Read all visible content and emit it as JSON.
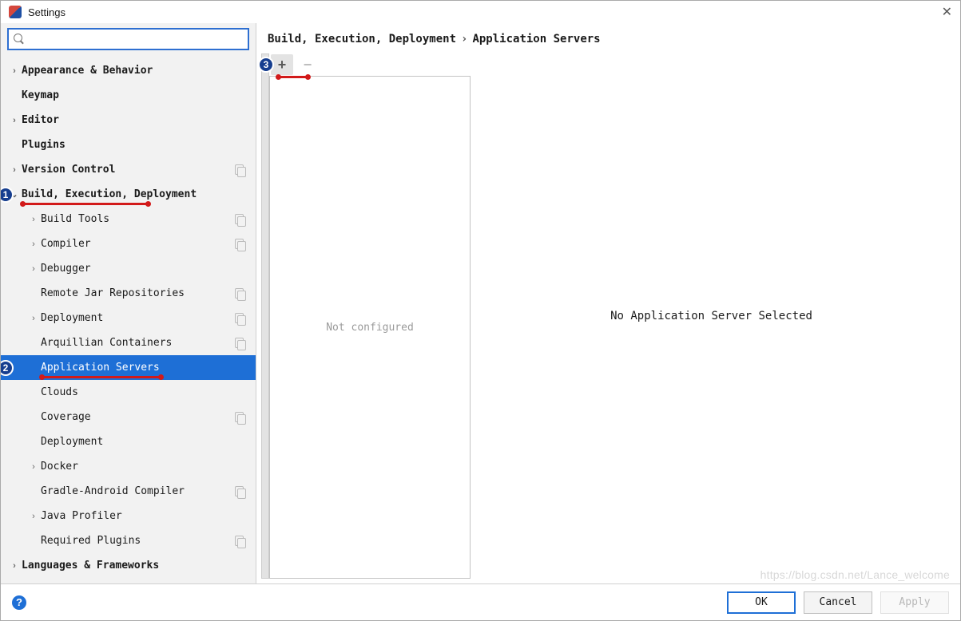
{
  "window": {
    "title": "Settings"
  },
  "search": {
    "value": "",
    "placeholder": ""
  },
  "tree": [
    {
      "label": "Appearance & Behavior",
      "bold": true,
      "chev": "›",
      "indent": 0
    },
    {
      "label": "Keymap",
      "bold": true,
      "chev": "",
      "indent": 0,
      "pad": 26
    },
    {
      "label": "Editor",
      "bold": true,
      "chev": "›",
      "indent": 0
    },
    {
      "label": "Plugins",
      "bold": true,
      "chev": "",
      "indent": 0,
      "pad": 26
    },
    {
      "label": "Version Control",
      "bold": true,
      "chev": "›",
      "indent": 0,
      "copy": true
    },
    {
      "label": "Build, Execution, Deployment",
      "bold": true,
      "chev": "⌄",
      "indent": 0,
      "badge": 1
    },
    {
      "label": "Build Tools",
      "bold": false,
      "chev": "›",
      "indent": 1,
      "copy": true
    },
    {
      "label": "Compiler",
      "bold": false,
      "chev": "›",
      "indent": 1,
      "copy": true
    },
    {
      "label": "Debugger",
      "bold": false,
      "chev": "›",
      "indent": 1
    },
    {
      "label": "Remote Jar Repositories",
      "bold": false,
      "chev": "",
      "indent": 1,
      "pad": 50,
      "copy": true
    },
    {
      "label": "Deployment",
      "bold": false,
      "chev": "›",
      "indent": 1,
      "copy": true
    },
    {
      "label": "Arquillian Containers",
      "bold": false,
      "chev": "",
      "indent": 1,
      "pad": 50,
      "copy": true
    },
    {
      "label": "Application Servers",
      "bold": false,
      "chev": "",
      "indent": 1,
      "pad": 50,
      "selected": true,
      "badge": 2
    },
    {
      "label": "Clouds",
      "bold": false,
      "chev": "",
      "indent": 1,
      "pad": 50
    },
    {
      "label": "Coverage",
      "bold": false,
      "chev": "",
      "indent": 1,
      "pad": 50,
      "copy": true
    },
    {
      "label": "Deployment",
      "bold": false,
      "chev": "",
      "indent": 1,
      "pad": 50
    },
    {
      "label": "Docker",
      "bold": false,
      "chev": "›",
      "indent": 1
    },
    {
      "label": "Gradle-Android Compiler",
      "bold": false,
      "chev": "",
      "indent": 1,
      "pad": 50,
      "copy": true
    },
    {
      "label": "Java Profiler",
      "bold": false,
      "chev": "›",
      "indent": 1
    },
    {
      "label": "Required Plugins",
      "bold": false,
      "chev": "",
      "indent": 1,
      "pad": 50,
      "copy": true
    },
    {
      "label": "Languages & Frameworks",
      "bold": true,
      "chev": "›",
      "indent": 0
    }
  ],
  "breadcrumb": {
    "parent": "Build, Execution, Deployment",
    "sep": "›",
    "current": "Application Servers"
  },
  "toolbar": {
    "add": "+",
    "remove": "−",
    "badge": 3
  },
  "list": {
    "empty_text": "Not configured"
  },
  "detail": {
    "empty_text": "No Application Server Selected"
  },
  "footer": {
    "ok": "OK",
    "cancel": "Cancel",
    "apply": "Apply"
  },
  "watermark": "https://blog.csdn.net/Lance_welcome"
}
